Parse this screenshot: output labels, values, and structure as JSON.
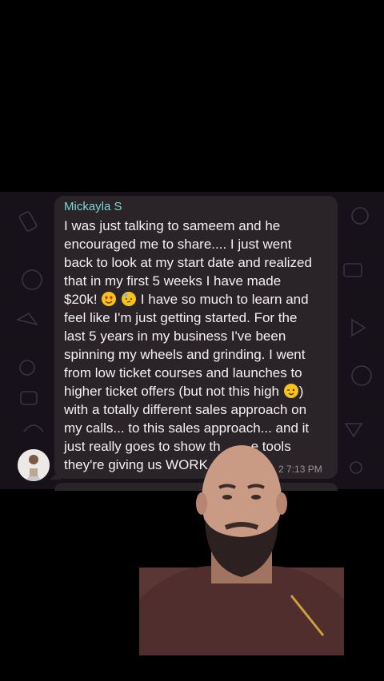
{
  "message": {
    "sender": "Mickayla S",
    "lines": [
      "I was just talking to sameem and he",
      "encouraged me to share.... I just went",
      "back to look at my start date and realized",
      "that in my first 5 weeks I have made",
      "$20k!",
      " I have so much to learn and",
      "feel like I'm just getting started. For the",
      "last 5 years in my business I've been",
      "spinning my wheels and grinding. I went",
      "from low ticket courses and launches to",
      "higher ticket offers (but not this high",
      ")",
      "with a totally different sales approach on",
      "my calls... to this sales approach... and it",
      "just really goes to show th",
      "e tools",
      "they're giving us WORK"
    ],
    "time": "2 7:13 PM"
  },
  "icons": {
    "heart_eyes": "heart-eyes-emoji-icon",
    "party": "partying-face-emoji-icon",
    "wink": "winking-face-emoji-icon"
  },
  "colors": {
    "sender": "#7ad7d0",
    "bubble": "#2a2429",
    "chat_background": "#17121a"
  }
}
